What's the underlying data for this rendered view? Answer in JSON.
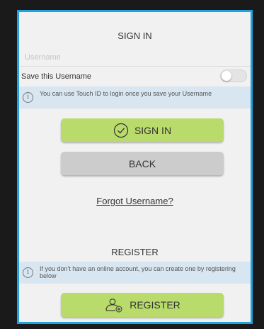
{
  "signin": {
    "title": "SIGN IN",
    "username_placeholder": "Username",
    "save_label": "Save this Username",
    "save_toggle_on": false,
    "touch_id_info": "You can use Touch ID to login once you save your Username",
    "signin_button": "SIGN IN",
    "back_button": "BACK",
    "forgot_link": "Forgot Username?"
  },
  "register": {
    "title": "REGISTER",
    "info": "If you don't have an online account, you can create one by registering below",
    "register_button": "REGISTER"
  },
  "icons": {
    "signin_button_icon": "check-circle-icon",
    "register_button_icon": "add-user-icon",
    "info_icon": "info-circle-icon"
  },
  "colors": {
    "frame_border": "#1fa3e0",
    "primary_button": "#b8db6c",
    "secondary_button": "#cccccc",
    "info_band": "#d8e6f1",
    "background": "#f1f1f1"
  }
}
